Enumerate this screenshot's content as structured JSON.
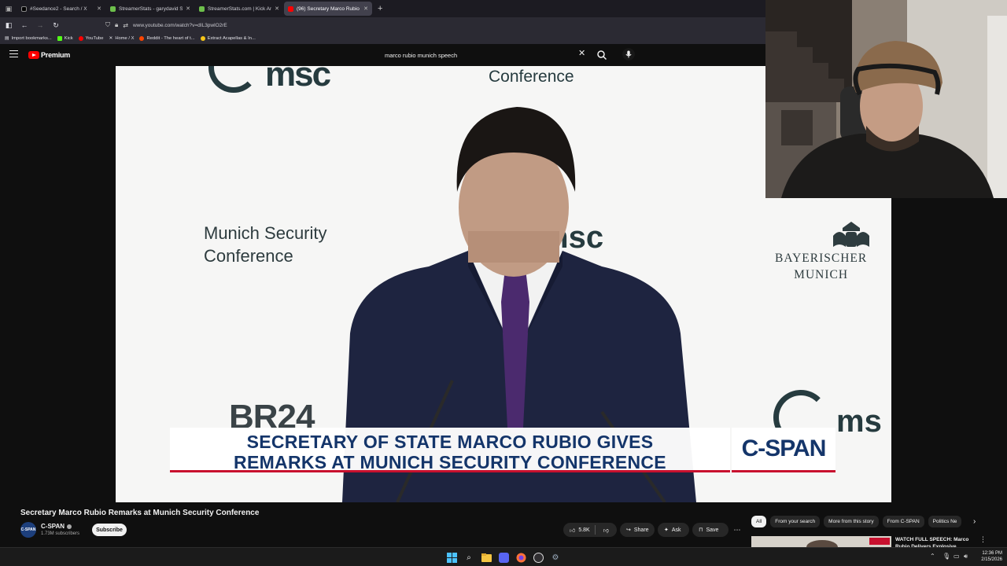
{
  "browser": {
    "tabs": [
      {
        "label": "#Seedance2 - Search / X",
        "favicon": "x-icon",
        "active": false
      },
      {
        "label": "StreamerStats - garydavid Strea",
        "favicon": "streamerstats-icon",
        "active": false
      },
      {
        "label": "StreamerStats.com | Kick Analyt",
        "favicon": "streamerstats-icon",
        "active": false
      },
      {
        "label": "(96) Secretary Marco Rubio",
        "favicon": "youtube-icon",
        "active": true
      }
    ],
    "url": "www.youtube.com/watch?v=dIL3pwlO2rE",
    "bookmarks": [
      "Import bookmarks...",
      "Kick",
      "YouTube",
      "Home / X",
      "Reddit - The heart of t...",
      "Extract Acapellas & In..."
    ]
  },
  "youtube": {
    "brand": "Premium",
    "search_query": "marco rubio munich speech"
  },
  "video": {
    "backdrop_top_msc": "msc",
    "backdrop_top_conference": "Conference",
    "backdrop_left_line1": "Munich Security",
    "backdrop_left_line2": "Conference",
    "backdrop_center_msc": "msc",
    "backdrop_right_line1": "BAYERISCHER",
    "backdrop_right_line2": "MUNICH",
    "backdrop_br24": "BR24",
    "backdrop_bottom_right_msc": "ms",
    "chyron_line1": "SECRETARY OF STATE MARCO RUBIO GIVES",
    "chyron_line2": "REMARKS AT MUNICH SECURITY CONFERENCE",
    "network": "C-SPAN"
  },
  "meta": {
    "title": "Secretary Marco Rubio Remarks at Munich Security Conference",
    "channel": "C-SPAN",
    "avatar_text": "C-SPAN",
    "subscribers": "1.73M subscribers",
    "subscribe_label": "Subscribe",
    "likes": "5.8K",
    "share_label": "Share",
    "ask_label": "Ask",
    "save_label": "Save"
  },
  "sidebar": {
    "chips": [
      "All",
      "From your search",
      "More from this story",
      "From C-SPAN",
      "Politics Ne"
    ],
    "rec_title": "WATCH FULL SPEECH: Marco Rubio Delivers Explosive"
  },
  "taskbar": {
    "time": "12:36 PM",
    "date": "2/15/2026"
  },
  "colors": {
    "youtube_red": "#ff0000",
    "cspan_navy": "#14356a",
    "cspan_red": "#c8102e"
  }
}
